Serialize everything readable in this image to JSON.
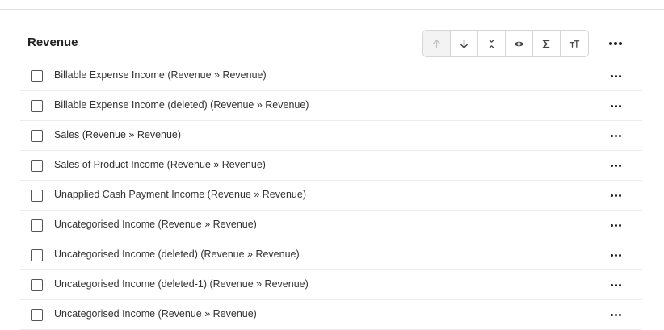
{
  "section": {
    "title": "Revenue"
  },
  "toolbar": {
    "buttons": [
      {
        "icon": "arrow-up-icon",
        "disabled": true
      },
      {
        "icon": "arrow-down-icon",
        "disabled": false
      },
      {
        "icon": "collapse-icon",
        "disabled": false
      },
      {
        "icon": "eye-icon",
        "disabled": false
      },
      {
        "icon": "sigma-icon",
        "disabled": false
      },
      {
        "icon": "text-size-icon",
        "disabled": false
      }
    ]
  },
  "rows": [
    {
      "label": "Billable Expense Income (Revenue » Revenue)"
    },
    {
      "label": "Billable Expense Income (deleted) (Revenue » Revenue)"
    },
    {
      "label": "Sales (Revenue » Revenue)"
    },
    {
      "label": "Sales of Product Income (Revenue » Revenue)"
    },
    {
      "label": "Unapplied Cash Payment Income (Revenue » Revenue)"
    },
    {
      "label": "Uncategorised Income (Revenue » Revenue)"
    },
    {
      "label": "Uncategorised Income (deleted) (Revenue » Revenue)"
    },
    {
      "label": "Uncategorised Income (deleted-1) (Revenue » Revenue)"
    },
    {
      "label": "Uncategorised Income (Revenue » Revenue)"
    }
  ]
}
